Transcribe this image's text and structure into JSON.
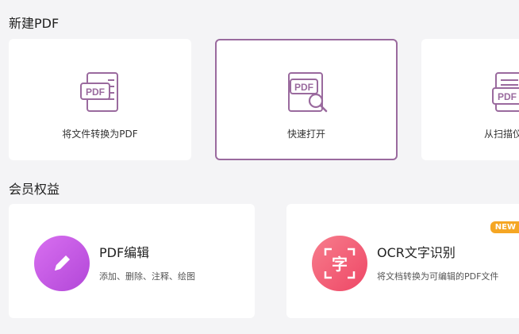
{
  "sections": {
    "new_pdf": "新建PDF",
    "member_benefits": "会员权益"
  },
  "new_cards": [
    {
      "label": "将文件转换为PDF",
      "icon": "pdf-document-icon"
    },
    {
      "label": "快速打开",
      "icon": "pdf-search-icon"
    },
    {
      "label": "从扫描仪",
      "icon": "pdf-scanner-icon"
    }
  ],
  "doc_icon_text": "PDF",
  "perks": [
    {
      "title": "PDF编辑",
      "desc": "添加、删除、注释、绘图",
      "icon": "pencil-icon",
      "color": "#c04fe0"
    },
    {
      "title": "OCR文字识别",
      "desc": "将文档转换为可编辑的PDF文件",
      "icon": "text-recognition-icon",
      "icon_char": "字",
      "color": "#f35b76",
      "badge": "NEW"
    }
  ],
  "colors": {
    "accent": "#9a6a9e",
    "badge": "#f5a623"
  }
}
